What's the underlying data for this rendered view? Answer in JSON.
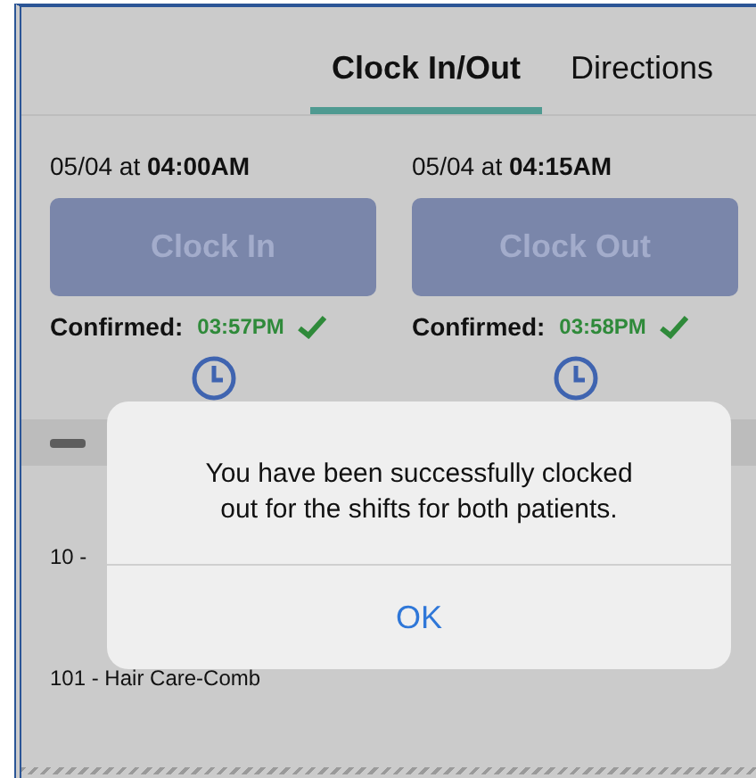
{
  "tabs": [
    {
      "label": "Clock In/Out",
      "selected": true
    },
    {
      "label": "Directions",
      "selected": false
    }
  ],
  "shifts": [
    {
      "date": "05/04 at **04:00AM**",
      "button": "Clock In",
      "disabled": true,
      "confirmed_label": "Confirmed:",
      "confirmed_time": "03:57PM"
    },
    {
      "date": "05/04 at **04:15AM**",
      "button": "Clock Out",
      "disabled": true,
      "confirmed_label": "Confirmed:",
      "confirmed_time": "03:58PM"
    }
  ],
  "tasks": [
    "10 -",
    "101 - Hair Care-Comb"
  ],
  "dialog": {
    "message": "You have been successfully clocked out for the shifts for both patients.",
    "button": "OK"
  }
}
